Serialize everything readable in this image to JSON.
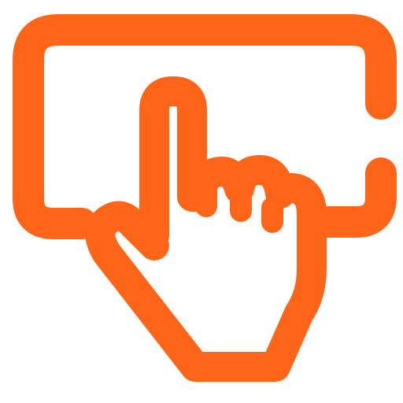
{
  "icon": {
    "name": "touch-screen-tap-icon",
    "color": "#FF6519",
    "background": "#FFFFFF"
  }
}
